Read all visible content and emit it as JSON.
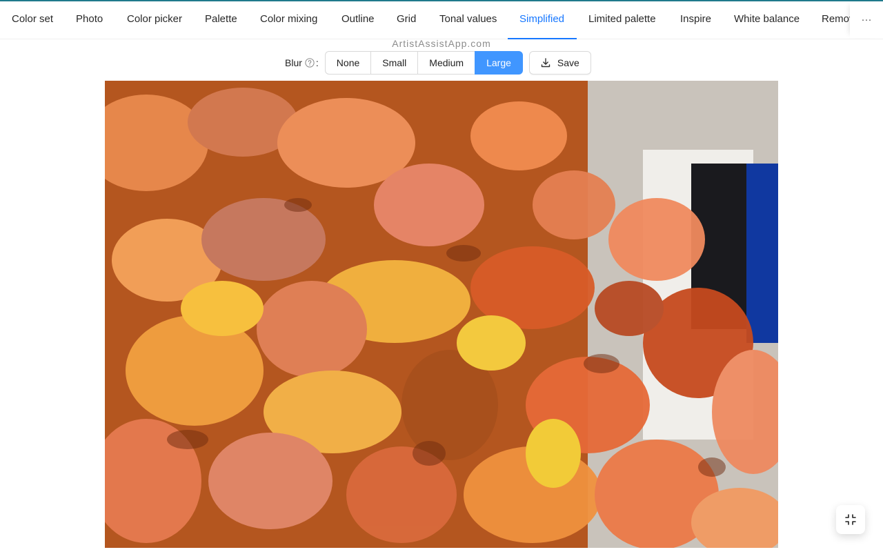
{
  "tabs": [
    {
      "label": "Color set"
    },
    {
      "label": "Photo"
    },
    {
      "label": "Color picker"
    },
    {
      "label": "Palette"
    },
    {
      "label": "Color mixing"
    },
    {
      "label": "Outline"
    },
    {
      "label": "Grid"
    },
    {
      "label": "Tonal values"
    },
    {
      "label": "Simplified"
    },
    {
      "label": "Limited palette"
    },
    {
      "label": "Inspire"
    },
    {
      "label": "White balance"
    },
    {
      "label": "Remov"
    }
  ],
  "active_tab": "Simplified",
  "more_label": "···",
  "watermark": "ArtistAssistApp.com",
  "blur": {
    "label": "Blur",
    "colon": ":",
    "options": [
      "None",
      "Small",
      "Medium",
      "Large"
    ],
    "selected": "Large"
  },
  "save_label": "Save",
  "colors": {
    "accent": "#1677ff",
    "selected_segment": "#4096ff",
    "top_line": "#1f7a8c"
  },
  "icons": {
    "help": "question-circle-icon",
    "save": "download-icon",
    "fullscreen_exit": "compress-icon",
    "more": "ellipsis-icon"
  }
}
